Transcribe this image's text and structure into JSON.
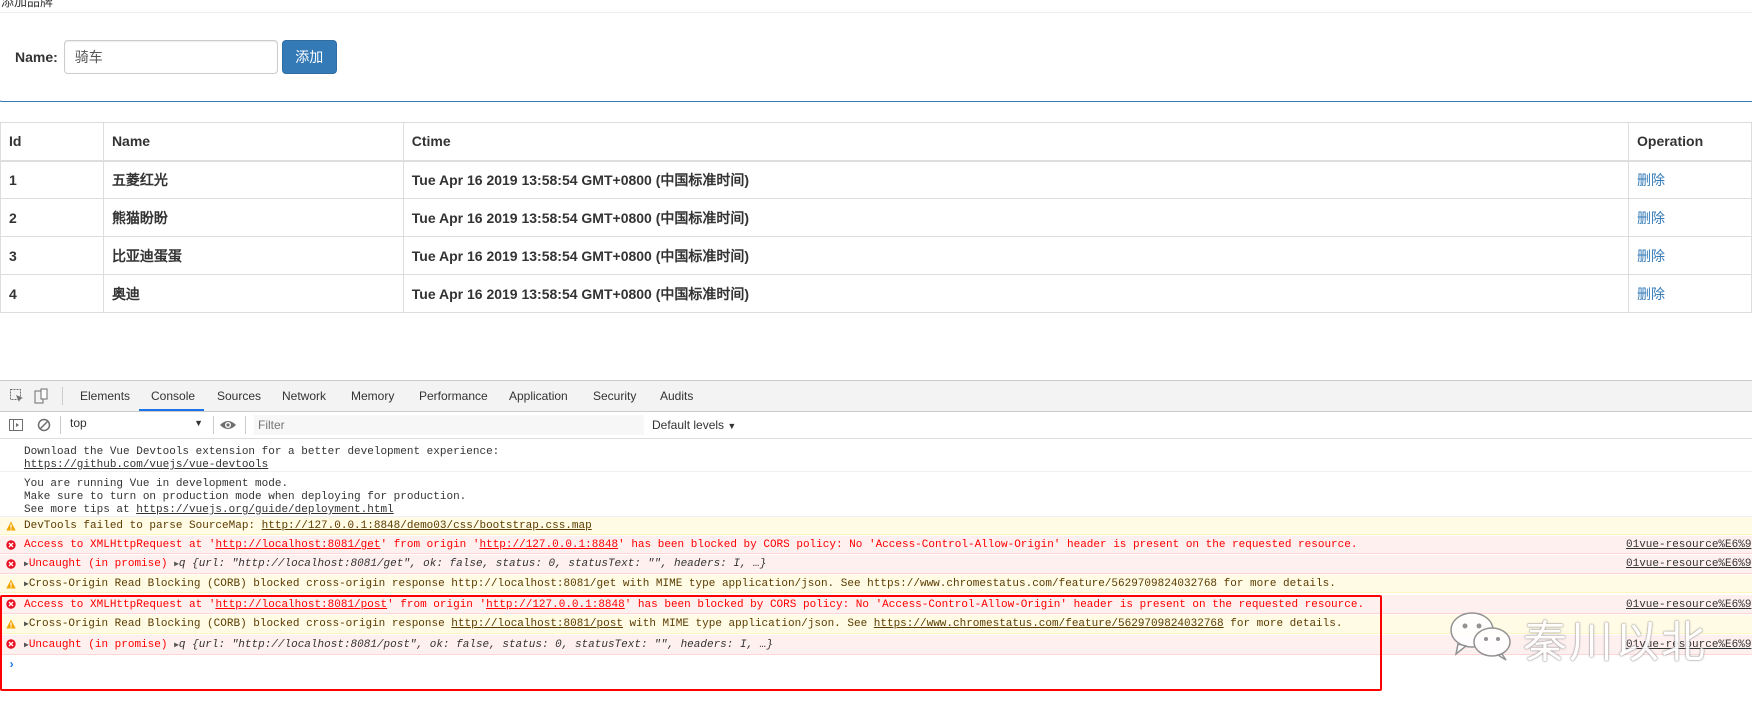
{
  "panel": {
    "title": "添加品牌",
    "name_label": "Name:",
    "name_value": "骑车",
    "add_button": "添加"
  },
  "table": {
    "headers": [
      "Id",
      "Name",
      "Ctime",
      "Operation"
    ],
    "rows": [
      {
        "id": "1",
        "name": "五菱红光",
        "ctime": "Tue Apr 16 2019 13:58:54 GMT+0800 (中国标准时间)",
        "op": "删除"
      },
      {
        "id": "2",
        "name": "熊猫盼盼",
        "ctime": "Tue Apr 16 2019 13:58:54 GMT+0800 (中国标准时间)",
        "op": "删除"
      },
      {
        "id": "3",
        "name": "比亚迪蛋蛋",
        "ctime": "Tue Apr 16 2019 13:58:54 GMT+0800 (中国标准时间)",
        "op": "删除"
      },
      {
        "id": "4",
        "name": "奥迪",
        "ctime": "Tue Apr 16 2019 13:58:54 GMT+0800 (中国标准时间)",
        "op": "删除"
      }
    ]
  },
  "devtools": {
    "tabs": [
      "Elements",
      "Console",
      "Sources",
      "Network",
      "Memory",
      "Performance",
      "Application",
      "Security",
      "Audits"
    ],
    "active_tab": "Console",
    "context": "top",
    "filter_placeholder": "Filter",
    "levels": "Default levels",
    "accent_color": "#1a73e8",
    "messages": {
      "m1a": "Download the Vue Devtools extension for a better development experience:",
      "m1b": "https://github.com/vuejs/vue-devtools",
      "m2a": "You are running Vue in development mode.",
      "m2b": "Make sure to turn on production mode when deploying for production.",
      "m2c_pre": "See more tips at ",
      "m2c_link": "https://vuejs.org/guide/deployment.html",
      "w1_pre": "DevTools failed to parse SourceMap: ",
      "w1_link": "http://127.0.0.1:8848/demo03/css/bootstrap.css.map",
      "e1_a": "Access to XMLHttpRequest at '",
      "e1_link1": "http://localhost:8081/get",
      "e1_b": "' from origin '",
      "e1_link2": "http://127.0.0.1:8848",
      "e1_c": "' has been blocked by CORS policy: No 'Access-Control-Allow-Origin' header is present on the requested resource.",
      "e2_a": "Uncaught (in promise) ",
      "e2_b": "q {url: \"http://localhost:8081/get\", ok: false, status: 0, statusText: \"\", headers: I, …}",
      "w2": "Cross-Origin Read Blocking (CORB) blocked cross-origin response http://localhost:8081/get with MIME type application/json. See https://www.chromestatus.com/feature/5629709824032768 for more details.",
      "e3_a": "Access to XMLHttpRequest at '",
      "e3_link1": "http://localhost:8081/post",
      "e3_b": "' from origin '",
      "e3_link2": "http://127.0.0.1:8848",
      "e3_c": "' has been blocked by CORS policy: No 'Access-Control-Allow-Origin' header is present on the requested resource.",
      "w3_a": "Cross-Origin Read Blocking (CORB) blocked cross-origin response ",
      "w3_link1": "http://localhost:8081/post",
      "w3_b": " with MIME type application/json. See ",
      "w3_link2": "https://www.chromestatus.com/feature/5629709824032768",
      "w3_c": " for more details.",
      "e4_a": "Uncaught (in promise) ",
      "e4_b": "q {url: \"http://localhost:8081/post\", ok: false, status: 0, statusText: \"\", headers: I, …}"
    },
    "source_link": "01vue-resource%E6%9"
  },
  "watermark": "秦川以北"
}
